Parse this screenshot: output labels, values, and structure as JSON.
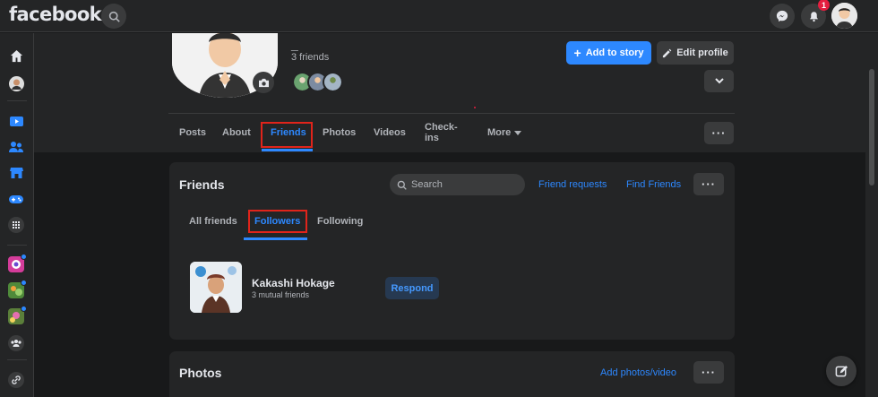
{
  "topbar": {
    "logo": "facebook",
    "notification_count": "1",
    "icons": [
      "search-icon",
      "messenger-icon",
      "bell-icon",
      "avatar"
    ]
  },
  "rail": {
    "icons": [
      "home-icon",
      "profile-avatar",
      "watch-icon",
      "friends-icon",
      "marketplace-icon",
      "gaming-icon",
      "menu-grid-icon",
      "group-avatar-1",
      "group-avatar-2",
      "group-avatar-3",
      "groups-icon",
      "link-icon"
    ]
  },
  "profile": {
    "name": "_",
    "friends_count": "3 friends",
    "add_story_label": "Add to story",
    "edit_profile_label": "Edit profile"
  },
  "tabs": [
    {
      "label": "Posts"
    },
    {
      "label": "About"
    },
    {
      "label": "Friends"
    },
    {
      "label": "Photos"
    },
    {
      "label": "Videos"
    },
    {
      "label": "Check-ins"
    },
    {
      "label": "More"
    }
  ],
  "friends_card": {
    "title": "Friends",
    "search_placeholder": "Search",
    "friend_requests": "Friend requests",
    "find_friends": "Find Friends",
    "subtabs": [
      {
        "label": "All friends"
      },
      {
        "label": "Followers"
      },
      {
        "label": "Following"
      }
    ],
    "follower": {
      "name": "Kakashi Hokage",
      "mutual": "3 mutual friends",
      "respond": "Respond"
    }
  },
  "photos_card": {
    "title": "Photos",
    "add_photos": "Add photos/video"
  },
  "colors": {
    "accent": "#2d88ff",
    "background": "#18191a",
    "surface": "#242526",
    "highlight_box": "#e0241b"
  }
}
